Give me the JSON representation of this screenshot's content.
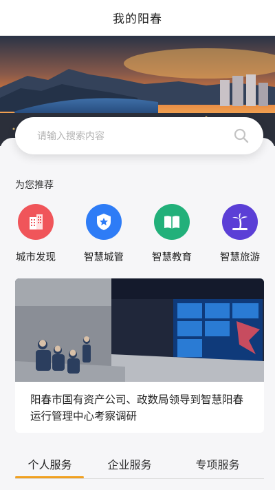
{
  "header": {
    "title": "我的阳春"
  },
  "search": {
    "placeholder": "请输入搜索内容",
    "icon": "search-icon"
  },
  "recommend": {
    "title": "为您推荐",
    "items": [
      {
        "label": "城市发现",
        "icon": "city-building-icon",
        "color": "#f0555a"
      },
      {
        "label": "智慧城管",
        "icon": "shield-star-icon",
        "color": "#2e7cf6"
      },
      {
        "label": "智慧教育",
        "icon": "book-icon",
        "color": "#22b07a"
      },
      {
        "label": "智慧旅游",
        "icon": "palm-tree-icon",
        "color": "#5b3fd6"
      }
    ]
  },
  "news": {
    "headline": "阳春市国有资产公司、政数局领导到智慧阳春运行管理中心考察调研"
  },
  "tabs": {
    "items": [
      {
        "label": "个人服务"
      },
      {
        "label": "企业服务"
      },
      {
        "label": "专项服务"
      }
    ],
    "active_index": 0,
    "accent": "#f0a020"
  }
}
